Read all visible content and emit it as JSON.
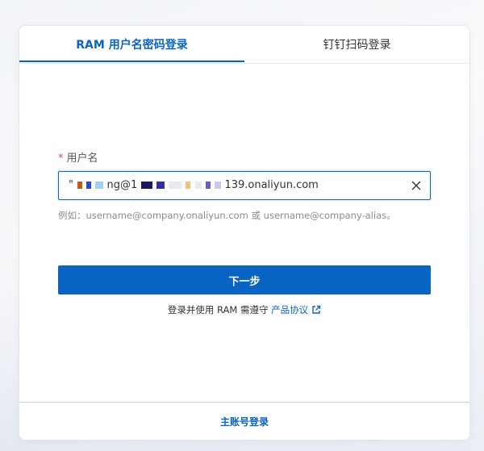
{
  "tabs": [
    {
      "label": "RAM 用户名密码登录",
      "active": true
    },
    {
      "label": "钉钉扫码登录",
      "active": false
    }
  ],
  "form": {
    "required_mark": "*",
    "username_label": "用户名",
    "username_value": {
      "prefix": "\"",
      "part_a": "ng@1",
      "part_b": "139.onaliyun.com",
      "mask_colors": [
        "#c05a1a",
        "#2e48c8",
        "#9fd0f0",
        "#1a1a5a",
        "#3030a0",
        "#f2c080",
        "#a0a0ff",
        "#6a5ac8"
      ]
    },
    "clear_icon": "close-icon",
    "hint": "例如：username@company.onaliyun.com 或 username@company-alias。",
    "next_button": "下一步"
  },
  "agreement": {
    "text": "登录并使用 RAM 需遵守",
    "link": "产品协议",
    "link_icon": "external-link-icon"
  },
  "footer": {
    "main_account_link": "主账号登录"
  },
  "colors": {
    "accent": "#0a64c4",
    "required": "#e5484d",
    "hint": "#8c8c8c"
  }
}
